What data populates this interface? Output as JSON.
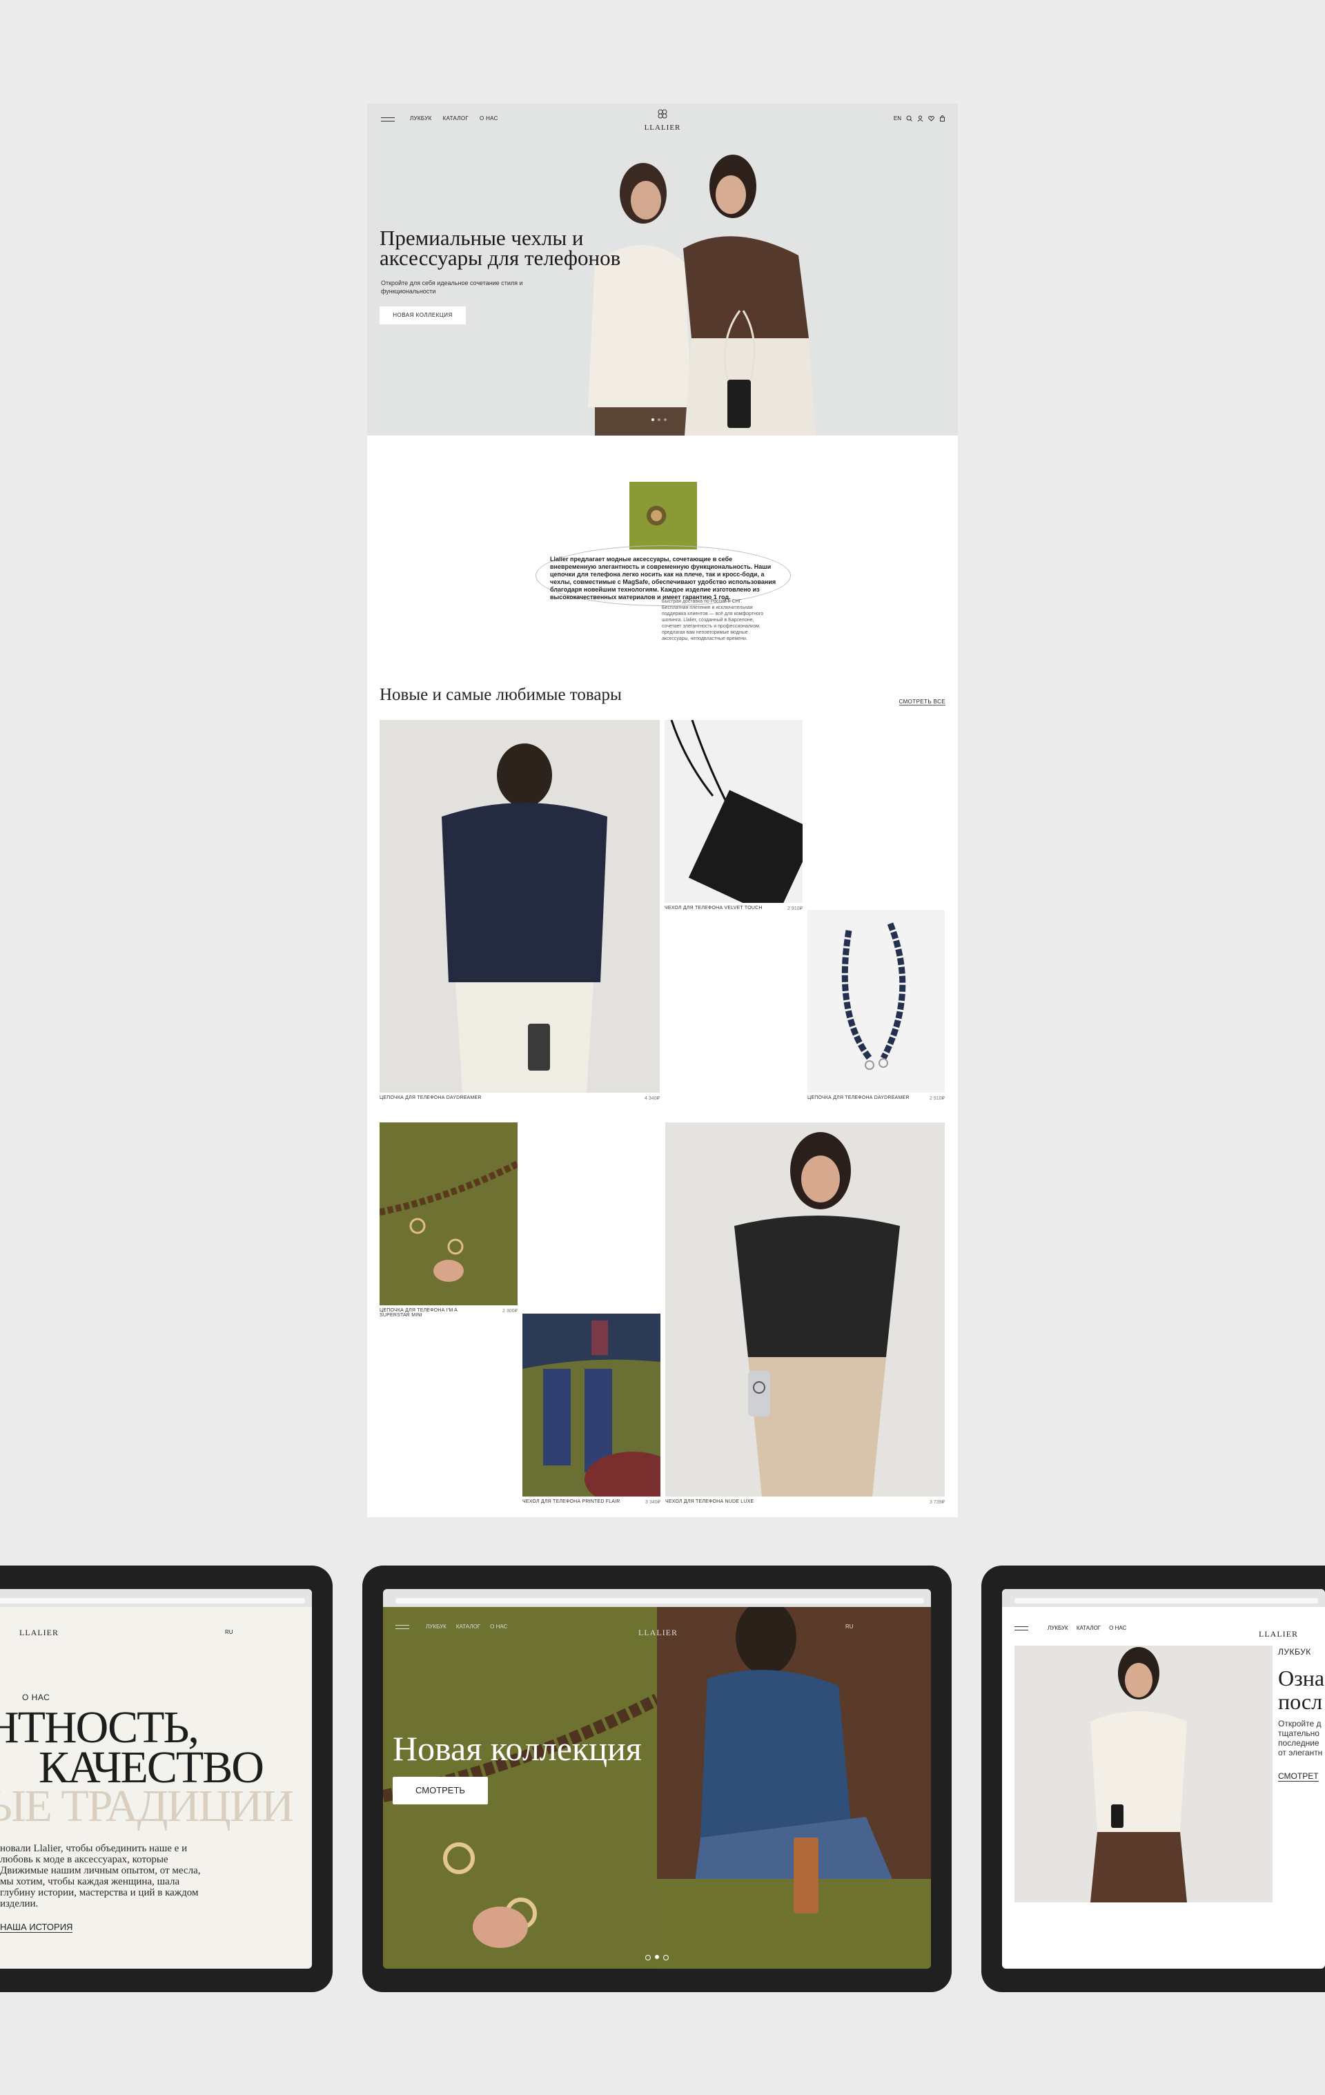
{
  "nav": {
    "links": [
      "ЛУКБУК",
      "КАТАЛОГ",
      "О НАС"
    ],
    "brand": "LLALIER",
    "lang": "EN"
  },
  "hero": {
    "title": "Премиальные чехлы и аксессуары для телефонов",
    "subtitle": "Откройте для себя идеальное сочетание стиля и функциональности",
    "button": "НОВАЯ КОЛЛЕКЦИЯ"
  },
  "about": {
    "text": "Llalier предлагает модные аксессуары, сочетающие в себе вневременную элегантность и современную функциональность. Наши цепочки для телефона легко носить как на плече, так и кросс-боди, а чехлы, совместимые с MagSafe, обеспечивают удобство использования благодаря новейшим технологиям. Каждое изделие изготовлено из высококачественных материалов и имеет гарантию 1 год.",
    "small": "Быстрая доставка по России и СНГ. Бесплатная плетение и исключительная поддержка клиентов — всё для комфортного шопинга. Llalier, созданный в Барселоне, сочетает элегантность и профессионализм, предлагая вам неповторимые модные аксессуары, неподвластные времени."
  },
  "products": {
    "title": "Новые и самые любимые товары",
    "see_all": "СМОТРЕТЬ ВСЕ",
    "items": [
      {
        "name": "ЦЕПОЧКА ДЛЯ ТЕЛЕФОНА DAYDREAMER",
        "price": "4 340₽"
      },
      {
        "name": "ЧЕХОЛ ДЛЯ ТЕЛЕФОНА VELVET TOUCH",
        "price": "2 910₽"
      },
      {
        "name": "ЦЕПОЧКА ДЛЯ ТЕЛЕФОНА DAYDREAMER",
        "price": "2 910₽"
      },
      {
        "name": "ЦЕПОЧКА ДЛЯ ТЕЛЕФОНА I'M A SUPERSTAR MINI",
        "price": "2 300₽"
      },
      {
        "name": "ЧЕХОЛ ДЛЯ ТЕЛЕФОНА PRINTED FLAIR",
        "price": "3 340₽"
      },
      {
        "name": "ЧЕХОЛ ДЛЯ ТЕЛЕФОНА NUDE LUXE",
        "price": "3 739₽"
      }
    ]
  },
  "tablet_left": {
    "brand": "LLALIER",
    "lang": "RU",
    "label": "О НАС",
    "line1": "НТНОСТЬ,",
    "line2": "КАЧЕСТВО",
    "line3": "ЫЕ ТРАДИЦИИ",
    "text": "новали Llalier, чтобы объединить наше е и любовь к моде в аксессуарах, которые Движимые нашим личным опытом, от месла, мы хотим, чтобы каждая женщина, шала глубину истории, мастерства и ций в каждом изделии.",
    "link": "НАША ИСТОРИЯ"
  },
  "tablet_center": {
    "links": [
      "ЛУКБУК",
      "КАТАЛОГ",
      "О НАС"
    ],
    "brand": "LLALIER",
    "lang": "RU",
    "title": "Новая коллекция",
    "button": "СМОТРЕТЬ"
  },
  "tablet_right": {
    "links": [
      "ЛУКБУК",
      "КАТАЛОГ",
      "О НАС"
    ],
    "brand": "LLALIER",
    "label": "ЛУКБУК",
    "title": "Озна посл",
    "text": "Откройте д тщательно последние от элегантн",
    "link": "СМОТРЕТ"
  },
  "colors": {
    "background": "#ebebeb",
    "olive": "#6f7330",
    "ink": "#222222"
  }
}
